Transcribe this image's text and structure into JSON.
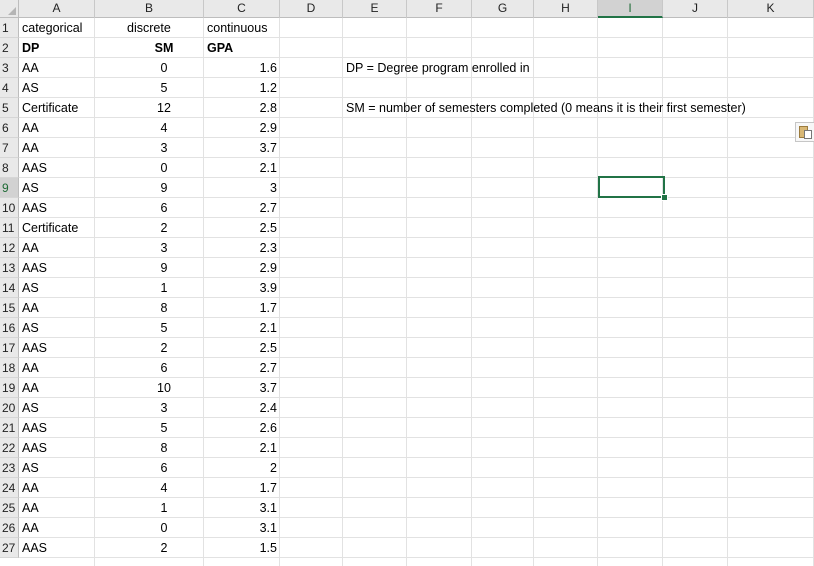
{
  "columns": [
    "A",
    "B",
    "C",
    "D",
    "E",
    "F",
    "G",
    "H",
    "I",
    "J",
    "K"
  ],
  "selected_column": "I",
  "selected_row": "9",
  "rows": [
    {
      "num": "1",
      "dp": "categorical",
      "sm": "discrete",
      "gpa": "continuous"
    },
    {
      "num": "2",
      "dp": "DP",
      "sm": "SM",
      "gpa": "GPA"
    },
    {
      "num": "3",
      "dp": "AA",
      "sm": "0",
      "gpa": "1.6"
    },
    {
      "num": "4",
      "dp": "AS",
      "sm": "5",
      "gpa": "1.2"
    },
    {
      "num": "5",
      "dp": "Certificate",
      "sm": "12",
      "gpa": "2.8"
    },
    {
      "num": "6",
      "dp": "AA",
      "sm": "4",
      "gpa": "2.9"
    },
    {
      "num": "7",
      "dp": "AA",
      "sm": "3",
      "gpa": "3.7"
    },
    {
      "num": "8",
      "dp": "AAS",
      "sm": "0",
      "gpa": "2.1"
    },
    {
      "num": "9",
      "dp": "AS",
      "sm": "9",
      "gpa": "3"
    },
    {
      "num": "10",
      "dp": "AAS",
      "sm": "6",
      "gpa": "2.7"
    },
    {
      "num": "11",
      "dp": "Certificate",
      "sm": "2",
      "gpa": "2.5"
    },
    {
      "num": "12",
      "dp": "AA",
      "sm": "3",
      "gpa": "2.3"
    },
    {
      "num": "13",
      "dp": "AAS",
      "sm": "9",
      "gpa": "2.9"
    },
    {
      "num": "14",
      "dp": "AS",
      "sm": "1",
      "gpa": "3.9"
    },
    {
      "num": "15",
      "dp": "AA",
      "sm": "8",
      "gpa": "1.7"
    },
    {
      "num": "16",
      "dp": "AS",
      "sm": "5",
      "gpa": "2.1"
    },
    {
      "num": "17",
      "dp": "AAS",
      "sm": "2",
      "gpa": "2.5"
    },
    {
      "num": "18",
      "dp": "AA",
      "sm": "6",
      "gpa": "2.7"
    },
    {
      "num": "19",
      "dp": "AA",
      "sm": "10",
      "gpa": "3.7"
    },
    {
      "num": "20",
      "dp": "AS",
      "sm": "3",
      "gpa": "2.4"
    },
    {
      "num": "21",
      "dp": "AAS",
      "sm": "5",
      "gpa": "2.6"
    },
    {
      "num": "22",
      "dp": "AAS",
      "sm": "8",
      "gpa": "2.1"
    },
    {
      "num": "23",
      "dp": "AS",
      "sm": "6",
      "gpa": "2"
    },
    {
      "num": "24",
      "dp": "AA",
      "sm": "4",
      "gpa": "1.7"
    },
    {
      "num": "25",
      "dp": "AA",
      "sm": "1",
      "gpa": "3.1"
    },
    {
      "num": "26",
      "dp": "AA",
      "sm": "0",
      "gpa": "3.1"
    },
    {
      "num": "27",
      "dp": "AAS",
      "sm": "2",
      "gpa": "1.5"
    }
  ],
  "notes": {
    "dp": "DP = Degree program enrolled in",
    "sm": "SM = number of semesters completed (0 means it is their first semester)"
  },
  "colors": {
    "accent": "#217346",
    "header_bg": "#e9e9e9",
    "gridline": "#e2e2e2"
  },
  "icons": {
    "paste_options": "paste-options-icon"
  }
}
